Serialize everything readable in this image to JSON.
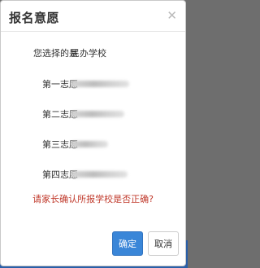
{
  "dialog": {
    "title": "报名意愿",
    "close_icon": "close-icon"
  },
  "rows": [
    {
      "label": "您选择的是",
      "value": "民办学校"
    },
    {
      "label": "第一志愿",
      "value": ""
    },
    {
      "label": "第二志愿",
      "value": ""
    },
    {
      "label": "第三志愿",
      "value": ""
    },
    {
      "label": "第四志愿",
      "value": ""
    }
  ],
  "message": "请家长确认所报学校是否正确?",
  "buttons": {
    "confirm": "确定",
    "cancel": "取消"
  },
  "colors": {
    "primary": "#3a86d8",
    "warning_text": "#c0392b"
  }
}
